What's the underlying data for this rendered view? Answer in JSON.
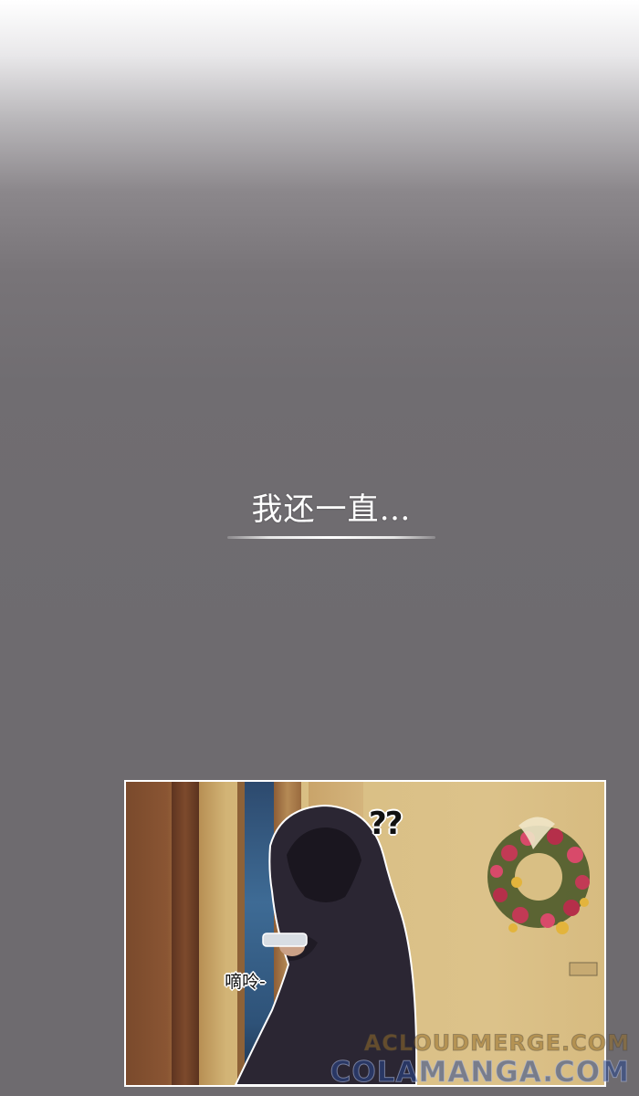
{
  "narration": {
    "text": "我还一直…"
  },
  "panel": {
    "sfx_question": "??",
    "sfx_ding": "嘀呤-"
  },
  "watermarks": {
    "line1": "ACLOUDMERGE.COM",
    "line2": "COLAMANGA.COM"
  },
  "colors": {
    "background": "#6e6b6f",
    "hoodie": "#2b2633",
    "wall": "#d9bf84",
    "door_frame": "#7a4a2c"
  }
}
